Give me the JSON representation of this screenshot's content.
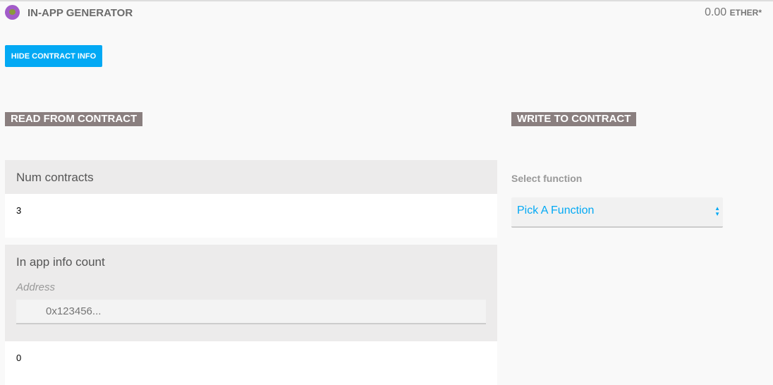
{
  "header": {
    "title": "IN-APP GENERATOR",
    "balance": "0.00",
    "unit": "ETHER*"
  },
  "toolbar": {
    "hide_label": "HIDE CONTRACT INFO"
  },
  "read": {
    "title": "READ FROM CONTRACT",
    "items": [
      {
        "label": "Num contracts",
        "value": "3"
      },
      {
        "label": "In app info count",
        "param_label": "Address",
        "placeholder": "0x123456...",
        "value": "0"
      }
    ]
  },
  "write": {
    "title": "WRITE TO CONTRACT",
    "select_label": "Select function",
    "select_value": "Pick A Function"
  }
}
